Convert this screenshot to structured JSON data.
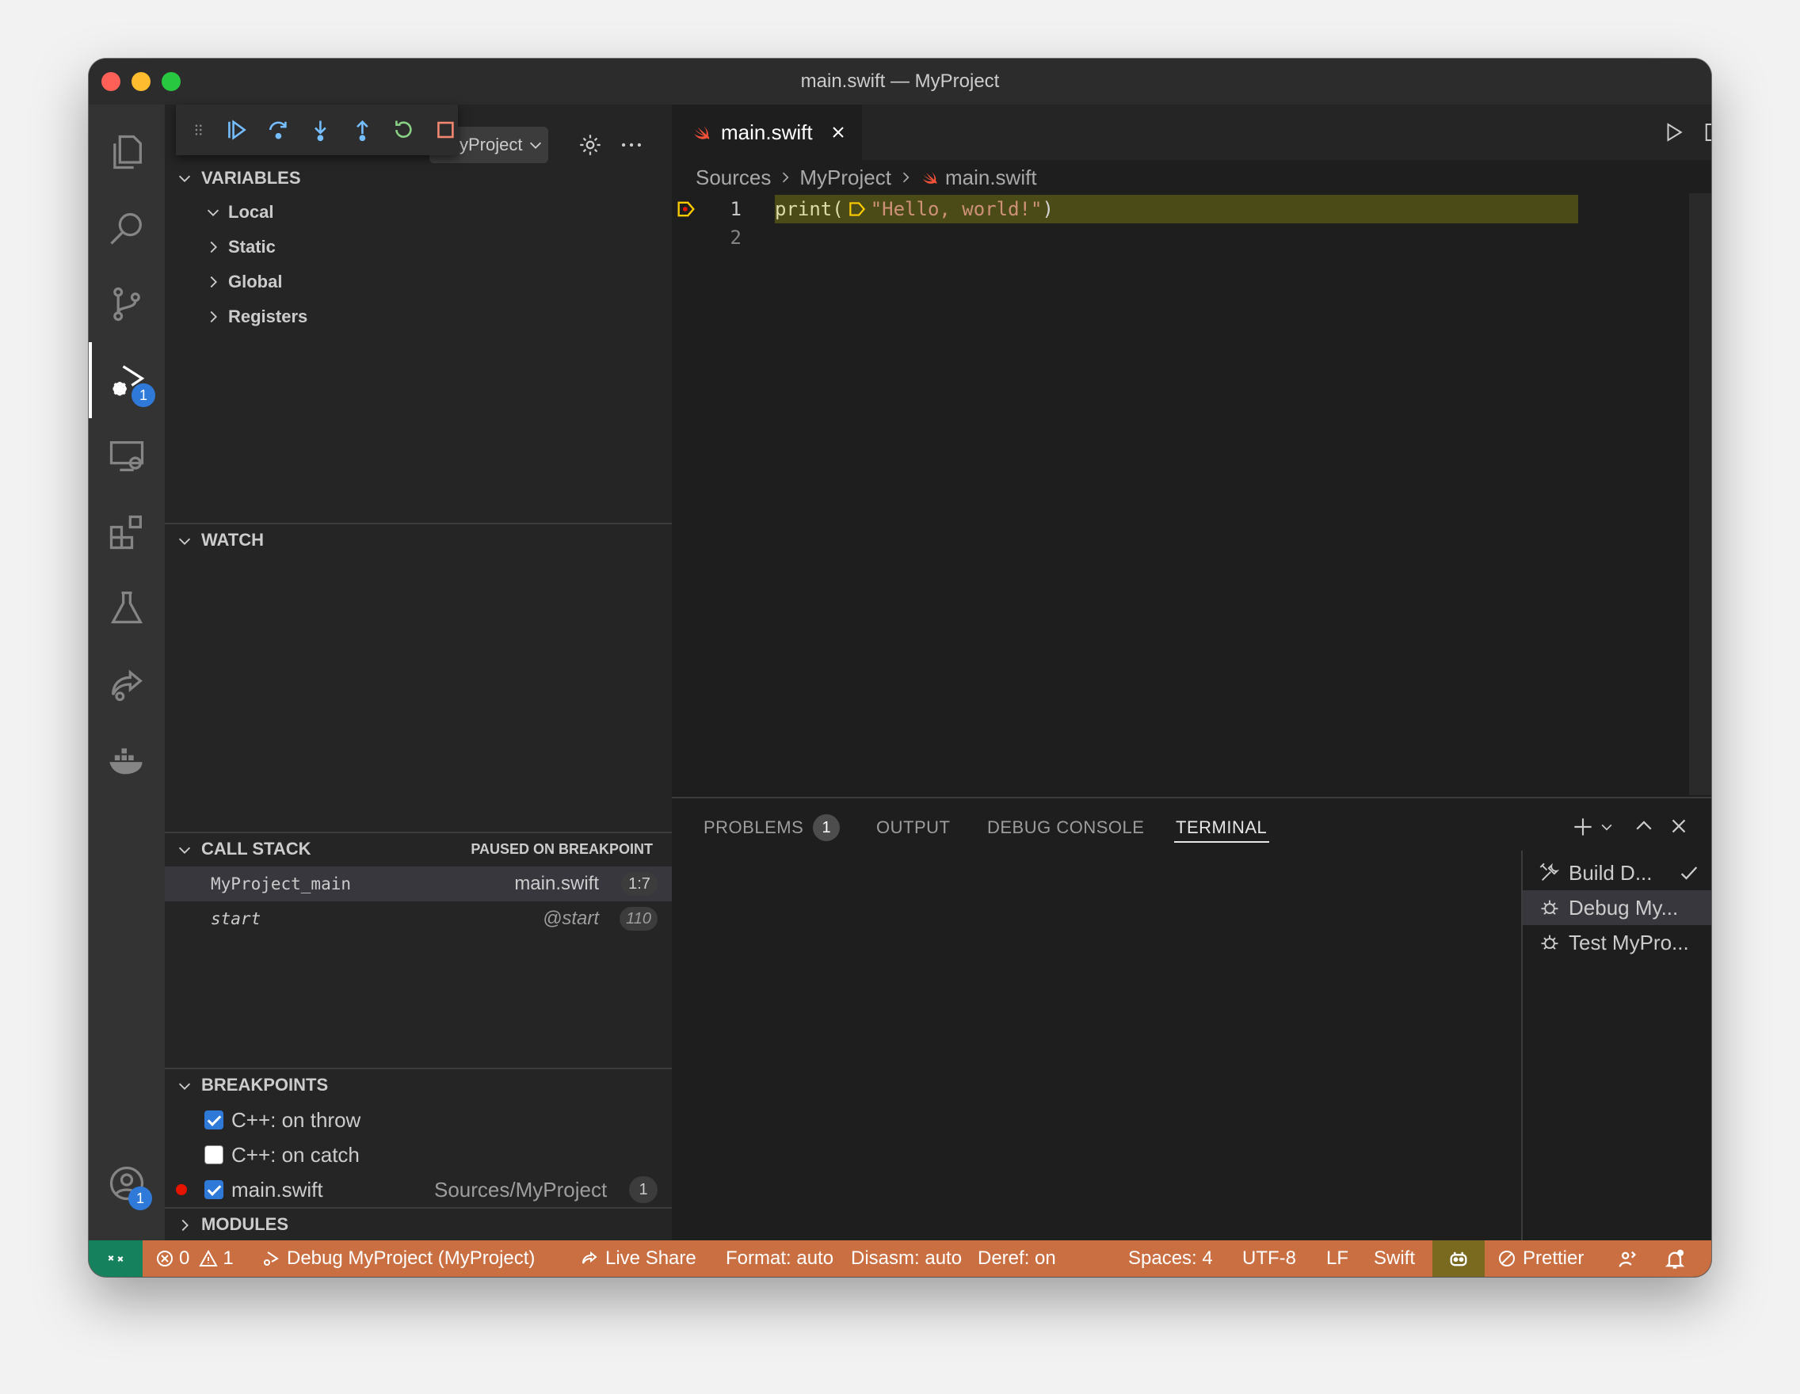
{
  "window": {
    "title": "main.swift — MyProject"
  },
  "activity_bar": {
    "items": [
      {
        "icon": "files-icon"
      },
      {
        "icon": "search-icon"
      },
      {
        "icon": "source-control-icon"
      },
      {
        "icon": "run-debug-icon",
        "badge": "1"
      },
      {
        "icon": "remote-explorer-icon"
      },
      {
        "icon": "extensions-icon"
      },
      {
        "icon": "testing-icon"
      },
      {
        "icon": "live-share-icon"
      },
      {
        "icon": "docker-icon"
      }
    ],
    "accounts_badge": "1"
  },
  "debug_toolbar": {
    "config_label": "yProject",
    "buttons": [
      "continue",
      "step-over",
      "step-into",
      "step-out",
      "restart",
      "stop"
    ]
  },
  "variables": {
    "title": "VARIABLES",
    "items": [
      "Local",
      "Static",
      "Global",
      "Registers"
    ]
  },
  "watch": {
    "title": "WATCH"
  },
  "call_stack": {
    "title": "CALL STACK",
    "status": "PAUSED ON BREAKPOINT",
    "frames": [
      {
        "fn": "MyProject_main",
        "file": "main.swift",
        "line": "1:7"
      },
      {
        "fn": "start",
        "file": "@start",
        "line": "110"
      }
    ]
  },
  "breakpoints": {
    "title": "BREAKPOINTS",
    "items": [
      {
        "label": "C++: on throw",
        "checked": true
      },
      {
        "label": "C++: on catch",
        "checked": false
      },
      {
        "label": "main.swift",
        "path": "Sources/MyProject",
        "count": "1",
        "checked": true
      }
    ]
  },
  "modules": {
    "title": "MODULES"
  },
  "editor": {
    "tab": "main.swift",
    "breadcrumb": [
      "Sources",
      "MyProject",
      "main.swift"
    ],
    "lines": [
      {
        "no": "1",
        "fn": "print(",
        "str": "\"Hello, world!\"",
        "close": ")"
      },
      {
        "no": "2"
      }
    ]
  },
  "panel": {
    "tabs": {
      "problems": "PROBLEMS",
      "problems_count": "1",
      "output": "OUTPUT",
      "debug_console": "DEBUG CONSOLE",
      "terminal": "TERMINAL"
    },
    "terminals": [
      {
        "label": "Build D...",
        "icon": "tools-icon"
      },
      {
        "label": "Debug My...",
        "icon": "debug-icon"
      },
      {
        "label": "Test MyPro...",
        "icon": "debug-icon"
      }
    ]
  },
  "status_bar": {
    "errors": "0",
    "warnings": "1",
    "debug": "Debug MyProject (MyProject)",
    "live_share": "Live Share",
    "format": "Format: auto",
    "disasm": "Disasm: auto",
    "deref": "Deref: on",
    "spaces": "Spaces: 4",
    "encoding": "UTF-8",
    "eol": "LF",
    "language": "Swift",
    "prettier": "Prettier"
  },
  "colors": {
    "status_bar": "#c96f42",
    "remote": "#16825d",
    "badge": "#2f7ad9",
    "breakpoint": "#e51400",
    "current_line": "#4b4b18"
  }
}
